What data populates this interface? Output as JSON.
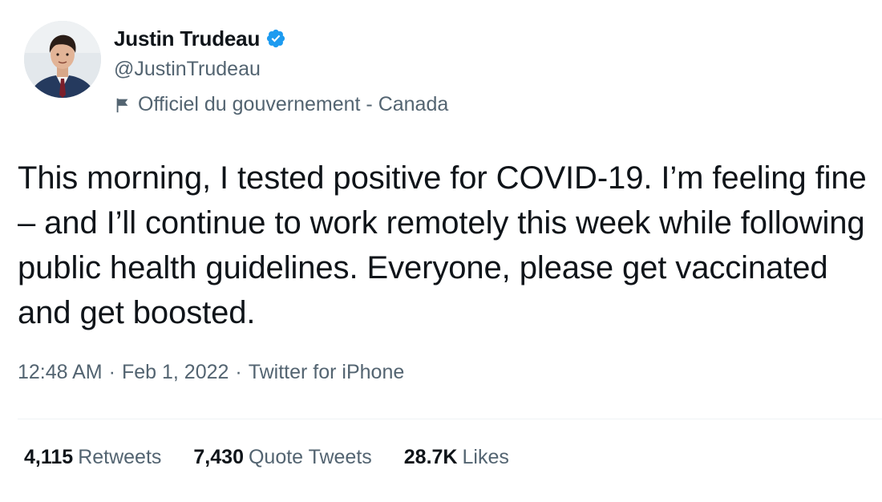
{
  "author": {
    "display_name": "Justin Trudeau",
    "handle": "@JustinTrudeau",
    "verified": true,
    "label": "Officiel du gouvernement - Canada"
  },
  "tweet": {
    "text": "This morning, I tested positive for COVID-19. I’m feeling fine – and I’ll continue to work remotely this week while following public health guidelines. Everyone, please get vaccinated and get boosted."
  },
  "meta": {
    "time": "12:48 AM",
    "separator": "·",
    "date": "Feb 1, 2022",
    "source": "Twitter for iPhone"
  },
  "stats": {
    "retweets": {
      "count": "4,115",
      "label": "Retweets"
    },
    "quote_tweets": {
      "count": "7,430",
      "label": "Quote Tweets"
    },
    "likes": {
      "count": "28.7K",
      "label": "Likes"
    }
  },
  "colors": {
    "verified_blue": "#1d9bf0",
    "text_primary": "#0f1419",
    "text_secondary": "#536471",
    "divider": "#eff3f4"
  },
  "icons": {
    "verified": "verified-badge-icon",
    "label": "flag-icon"
  }
}
